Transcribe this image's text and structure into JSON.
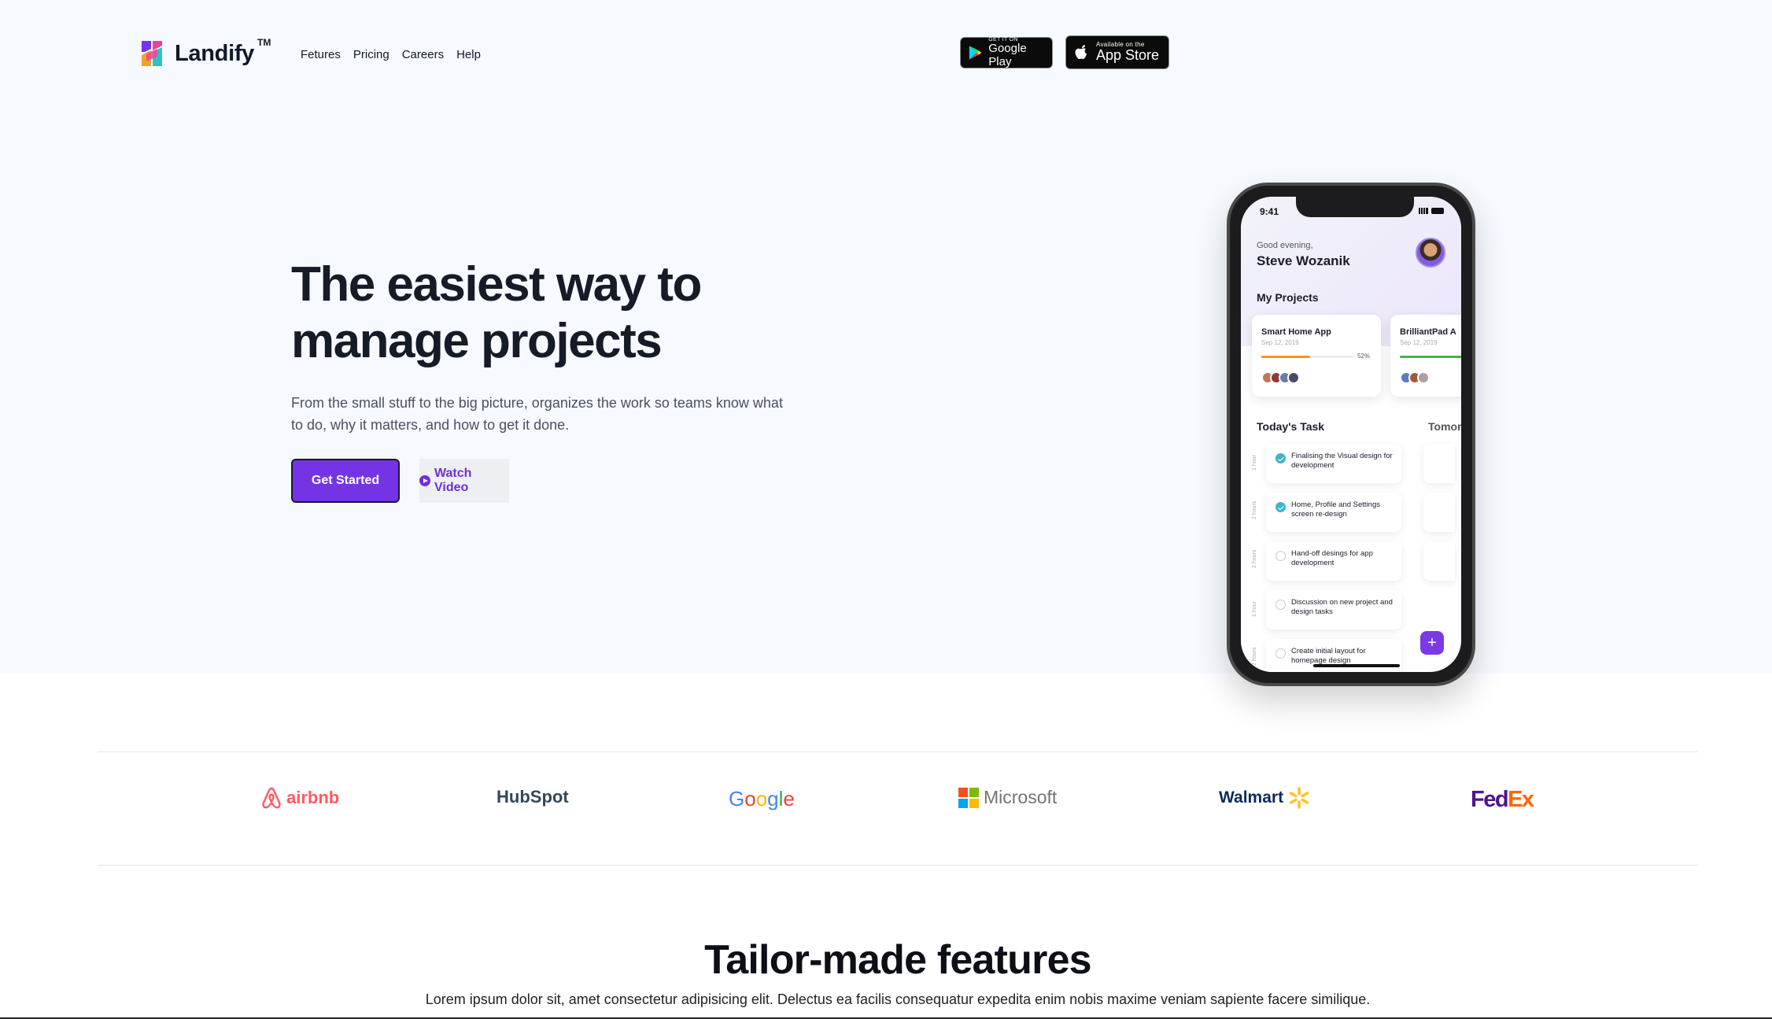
{
  "header": {
    "brand": "Landify",
    "brand_tm": "TM",
    "nav": [
      "Fetures",
      "Pricing",
      "Careers",
      "Help"
    ],
    "google_play": {
      "small": "GET IT ON",
      "big": "Google Play"
    },
    "app_store": {
      "small": "Available on the",
      "big": "App Store"
    }
  },
  "hero": {
    "headline": "The easiest way to manage projects",
    "subcopy": "From the small stuff to the big picture, organizes the work so teams know what to do, why it matters, and how to get it done.",
    "primary_cta": "Get Started",
    "secondary_cta": "Watch Video"
  },
  "phone": {
    "time": "9:41",
    "greeting": "Good evening,",
    "user": "Steve Wozanik",
    "projects_title": "My Projects",
    "projects": [
      {
        "name": "Smart Home App",
        "date": "Sep 12, 2019",
        "progress_pct": "52%",
        "progress": 0.52,
        "color": "#f7931e"
      },
      {
        "name": "BrilliantPad A",
        "date": "Sep 12, 2019",
        "progress_pct": "",
        "progress": 1.0,
        "color": "#4caf50"
      }
    ],
    "tasks_title": "Today's Task",
    "tomorrow_title": "Tomor",
    "tasks": [
      {
        "text": "Finalising the Visual design for development",
        "hours": "1 hour",
        "done": true
      },
      {
        "text": "Home, Profile and Settings screen re-design",
        "hours": "2 hours",
        "done": true
      },
      {
        "text": "Hand-off desings for app development",
        "hours": "2 hours",
        "done": false
      },
      {
        "text": "Discussion on new project and design tasks",
        "hours": "1 hour",
        "done": false
      },
      {
        "text": "Create initial layout for homepage design",
        "hours": "2 hours",
        "done": false
      }
    ],
    "fab": "+"
  },
  "logos": [
    "airbnb",
    "HubSpot",
    "Google",
    "Microsoft",
    "Walmart",
    "FedEx"
  ],
  "features": {
    "title": "Tailor-made features",
    "subtitle": "Lorem ipsum dolor sit, amet consectetur adipisicing elit. Delectus ea facilis consequatur expedita enim nobis maxime veniam sapiente facere similique."
  },
  "colors": {
    "primary": "#7434e6",
    "hero_bg": "#f6f9fe",
    "dark": "#161b28"
  }
}
